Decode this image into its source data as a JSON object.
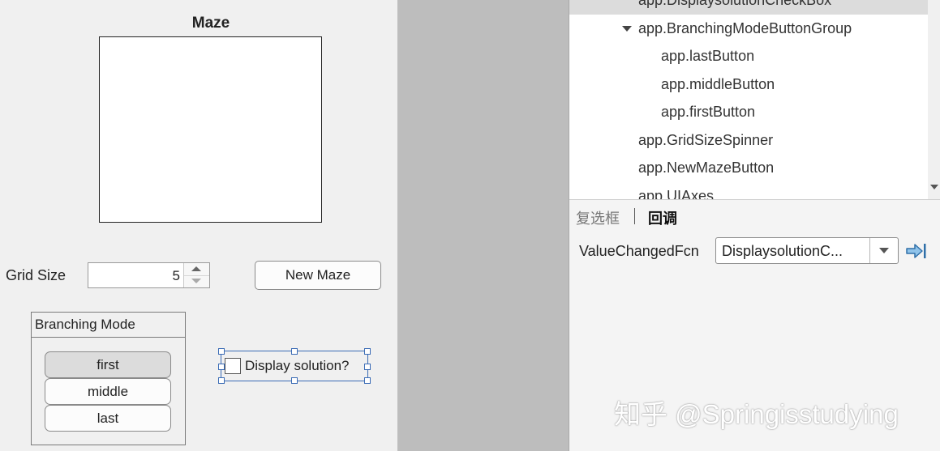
{
  "canvas": {
    "axes_title": "Maze",
    "grid_size_label": "Grid Size",
    "grid_size_value": "5",
    "new_maze_label": "New Maze",
    "branching_group_title": "Branching Mode",
    "branching_buttons": [
      "first",
      "middle",
      "last"
    ],
    "selected_branch": "first",
    "display_solution_label": "Display solution?"
  },
  "component_tree": {
    "items": [
      {
        "label": "app.DisplaysolutionCheckBox"
      },
      {
        "label": "app.BranchingModeButtonGroup"
      },
      {
        "label": "app.lastButton"
      },
      {
        "label": "app.middleButton"
      },
      {
        "label": "app.firstButton"
      },
      {
        "label": "app.GridSizeSpinner"
      },
      {
        "label": "app.NewMazeButton"
      },
      {
        "label": "app.UIAxes"
      }
    ]
  },
  "inspector": {
    "tabs": [
      "复选框",
      "回调"
    ],
    "active_tab": "回调",
    "property_label": "ValueChangedFcn",
    "property_value": "DisplaysolutionC..."
  },
  "watermark": "知乎 @Springisstudying",
  "colors": {
    "selection_blue": "#3a6bb5",
    "gutter_gray": "#bdbdbd",
    "panel_bg": "#f0f0f0"
  },
  "icons": {
    "goto_callback": "arrow-right-to-bar-icon"
  }
}
